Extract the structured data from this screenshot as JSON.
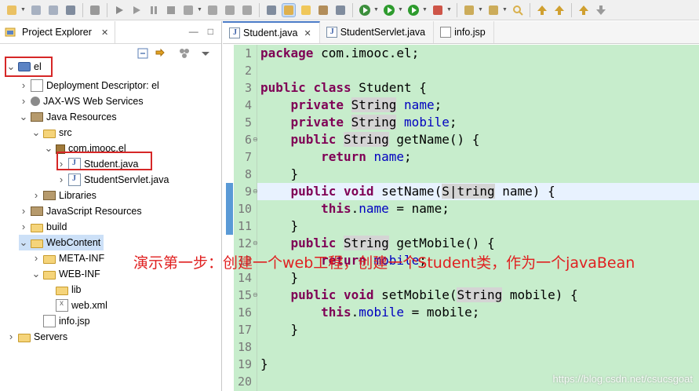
{
  "toolbar": {
    "icons": [
      "new-icon",
      "save-icon",
      "save-all-icon",
      "print-icon",
      "debug-icon",
      "skip-breakpoints-icon",
      "resume-icon",
      "suspend-icon",
      "terminate-icon",
      "disconnect-icon",
      "step-into-icon",
      "step-over-icon",
      "step-return-icon",
      "show-whitespace-icon",
      "highlight-icon",
      "mark-occurrences-icon",
      "toggle-block-icon",
      "toggle-word-wrap-icon",
      "debug-run-icon",
      "run-icon",
      "coverage-icon",
      "external-tools-icon",
      "open-type-icon",
      "open-task-icon",
      "search-icon",
      "next-annotation-icon",
      "previous-annotation-icon",
      "back-icon",
      "forward-icon"
    ]
  },
  "left_pane": {
    "title": "Project Explorer",
    "close": "✕",
    "minimize": "—",
    "maximize": "□",
    "tree": [
      {
        "label": "el",
        "icon": "project-icon",
        "expanded": true,
        "indent": 0
      },
      {
        "label": "Deployment Descriptor: el",
        "icon": "deployment-descriptor-icon",
        "expanded": false,
        "indent": 1
      },
      {
        "label": "JAX-WS Web Services",
        "icon": "web-services-icon",
        "expanded": false,
        "indent": 1
      },
      {
        "label": "Java Resources",
        "icon": "java-resources-icon",
        "expanded": true,
        "indent": 1
      },
      {
        "label": "src",
        "icon": "source-folder-icon",
        "expanded": true,
        "indent": 2
      },
      {
        "label": "com.imooc.el",
        "icon": "package-icon",
        "expanded": true,
        "indent": 3
      },
      {
        "label": "Student.java",
        "icon": "java-file-icon",
        "expanded": false,
        "indent": 4
      },
      {
        "label": "StudentServlet.java",
        "icon": "java-file-icon",
        "expanded": false,
        "indent": 4
      },
      {
        "label": "Libraries",
        "icon": "libraries-icon",
        "expanded": false,
        "indent": 2
      },
      {
        "label": "JavaScript Resources",
        "icon": "javascript-resources-icon",
        "expanded": false,
        "indent": 1
      },
      {
        "label": "build",
        "icon": "folder-icon",
        "expanded": false,
        "indent": 1
      },
      {
        "label": "WebContent",
        "icon": "folder-icon",
        "expanded": true,
        "indent": 1,
        "selected": true
      },
      {
        "label": "META-INF",
        "icon": "folder-icon",
        "expanded": false,
        "indent": 2
      },
      {
        "label": "WEB-INF",
        "icon": "folder-icon",
        "expanded": true,
        "indent": 2
      },
      {
        "label": "lib",
        "icon": "folder-icon",
        "expanded": false,
        "indent": 3,
        "leaf": true
      },
      {
        "label": "web.xml",
        "icon": "xml-file-icon",
        "expanded": false,
        "indent": 3,
        "leaf": true
      },
      {
        "label": "info.jsp",
        "icon": "jsp-file-icon",
        "expanded": false,
        "indent": 2,
        "leaf": true
      },
      {
        "label": "Servers",
        "icon": "folder-icon",
        "expanded": false,
        "indent": 0
      }
    ]
  },
  "editor": {
    "tabs": [
      {
        "label": "Student.java",
        "active": true,
        "close": "✕"
      },
      {
        "label": "StudentServlet.java",
        "active": false
      },
      {
        "label": "info.jsp",
        "active": false
      }
    ],
    "line_numbers": [
      "1",
      "2",
      "3",
      "4",
      "5",
      "6",
      "7",
      "8",
      "9",
      "10",
      "11",
      "12",
      "13",
      "14",
      "15",
      "16",
      "17",
      "18",
      "19",
      "20"
    ],
    "fold_markers": [
      "6",
      "9",
      "12",
      "15"
    ],
    "current_line": "9"
  },
  "annotation": "演示第一步：创建一个web工程，创建一个Student类，作为一个javaBean",
  "watermark": "https://blog.csdn.net/csucsgoat"
}
